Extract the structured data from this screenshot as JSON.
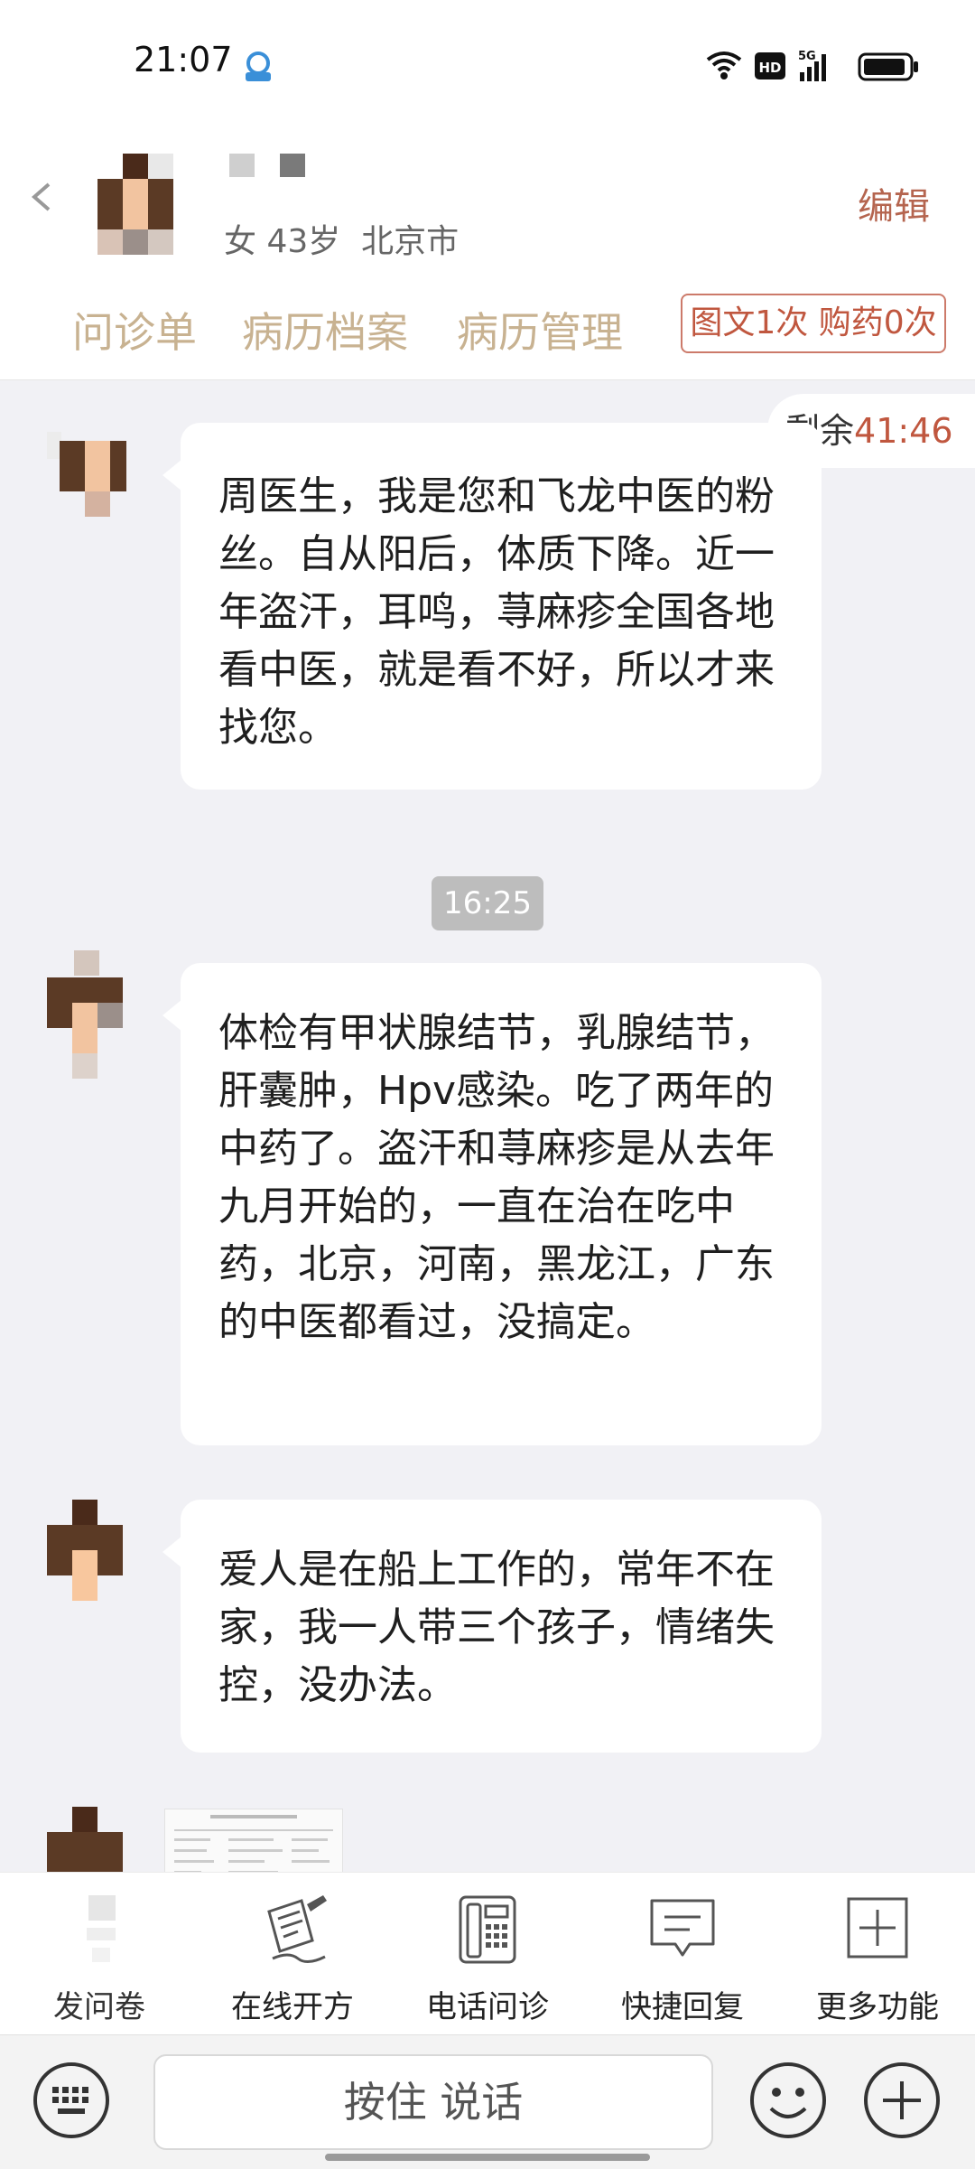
{
  "status_bar": {
    "time": "21:07",
    "hd_badge": "HD",
    "network": "5G"
  },
  "header": {
    "patient_info": "女 43岁  北京市",
    "edit_label": "编辑",
    "tabs": [
      "问诊单",
      "病历档案",
      "病历管理"
    ],
    "count_badge": "图文1次 购药0次"
  },
  "timer": {
    "label": "剩余",
    "value": "41:46"
  },
  "messages": [
    {
      "text": "周医生，我是您和飞龙中医的粉丝。自从阳后，体质下降。近一年盗汗，耳鸣，荨麻疹全国各地看中医，就是看不好，所以才来找您。"
    },
    {
      "text": "体检有甲状腺结节，乳腺结节，肝囊肿，Hpv感染。吃了两年的中药了。盗汗和荨麻疹是从去年九月开始的，一直在治在吃中药，北京，河南，黑龙江，广东的中医都看过，没搞定。"
    },
    {
      "text": "爱人是在船上工作的，常年不在家，我一人带三个孩子，情绪失控，没办法。"
    }
  ],
  "time_divider": "16:25",
  "toolbar": {
    "items": [
      {
        "label": "发问卷",
        "icon": "questionnaire-icon"
      },
      {
        "label": "在线开方",
        "icon": "prescription-icon"
      },
      {
        "label": "电话问诊",
        "icon": "phone-icon"
      },
      {
        "label": "快捷回复",
        "icon": "quick-reply-icon"
      },
      {
        "label": "更多功能",
        "icon": "more-icon"
      }
    ]
  },
  "input": {
    "hold_to_talk": "按住 说话"
  },
  "colors": {
    "accent": "#c0573f",
    "tab": "#c8b291",
    "background": "#f1f1f5"
  }
}
